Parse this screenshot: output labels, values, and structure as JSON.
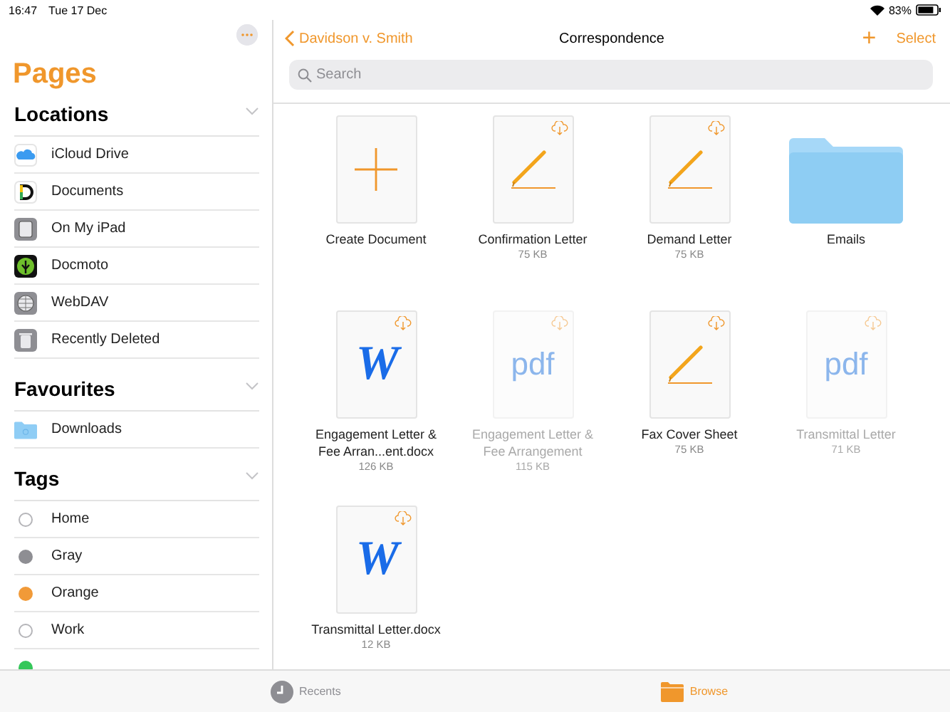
{
  "status_bar": {
    "time": "16:47",
    "date": "Tue 17 Dec",
    "battery": "83%"
  },
  "sidebar": {
    "title": "Pages",
    "sections": [
      {
        "title": "Locations",
        "expanded": true,
        "items": [
          {
            "label": "iCloud Drive",
            "kind": "icloud"
          },
          {
            "label": "Documents",
            "kind": "documents"
          },
          {
            "label": "On My iPad",
            "kind": "ipad"
          },
          {
            "label": "Docmoto",
            "kind": "docmoto"
          },
          {
            "label": "WebDAV",
            "kind": "webdav"
          },
          {
            "label": "Recently Deleted",
            "kind": "trash"
          }
        ]
      },
      {
        "title": "Favourites",
        "expanded": true,
        "items": [
          {
            "label": "Downloads",
            "kind": "folder"
          }
        ]
      },
      {
        "title": "Tags",
        "expanded": true,
        "items": [
          {
            "label": "Home",
            "kind": "tag",
            "color": "#ffffff"
          },
          {
            "label": "Gray",
            "kind": "tag",
            "color": "#8e8e93"
          },
          {
            "label": "Orange",
            "kind": "tag",
            "color": "#f19a38"
          },
          {
            "label": "Work",
            "kind": "tag",
            "color": "#ffffff"
          },
          {
            "kind": "tag",
            "color": "#34c759"
          }
        ]
      }
    ]
  },
  "nav": {
    "back": "Davidson v. Smith",
    "title": "Correspondence",
    "add": "+",
    "select": "Select"
  },
  "search": {
    "placeholder": "Search"
  },
  "files": [
    {
      "name": "Create Document",
      "kind": "create"
    },
    {
      "name": "Confirmation Letter",
      "size": "75 KB",
      "kind": "pages",
      "in_cloud": true,
      "dimmed": false
    },
    {
      "name": "Demand Letter",
      "size": "75 KB",
      "kind": "pages",
      "in_cloud": true,
      "dimmed": false
    },
    {
      "name": "Emails",
      "kind": "folder"
    },
    {
      "name": "Engagement Letter & Fee Arran...ent.docx",
      "size": "126 KB",
      "kind": "word",
      "glyph": "W",
      "in_cloud": true,
      "dimmed": false
    },
    {
      "name": "Engagement Letter & Fee Arrangement",
      "size": "115 KB",
      "kind": "pdf",
      "glyph": "pdf",
      "in_cloud": true,
      "dimmed": true
    },
    {
      "name": "Fax Cover Sheet",
      "size": "75 KB",
      "kind": "pages",
      "in_cloud": true,
      "dimmed": false
    },
    {
      "name": "Transmittal Letter",
      "size": "71 KB",
      "kind": "pdf",
      "glyph": "pdf",
      "in_cloud": true,
      "dimmed": true
    },
    {
      "name": "Transmittal Letter.docx",
      "size": "12 KB",
      "kind": "word",
      "glyph": "W",
      "in_cloud": true,
      "dimmed": false
    }
  ],
  "tabs": [
    {
      "label": "Recents",
      "kind": "recents",
      "selected": false
    },
    {
      "label": "Browse",
      "kind": "browse",
      "selected": true
    }
  ]
}
